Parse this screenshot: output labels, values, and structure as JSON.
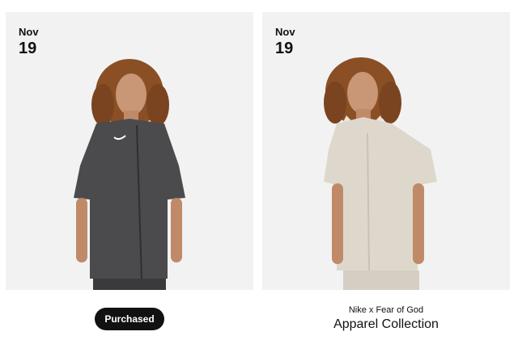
{
  "cards": [
    {
      "date": {
        "month": "Nov",
        "day": "19"
      },
      "shirt_color": "#4b4b4e",
      "button_label": "Purchased"
    },
    {
      "date": {
        "month": "Nov",
        "day": "19"
      },
      "shirt_color": "#ddd8cb",
      "subtitle": "Nike x Fear of God",
      "title": "Apparel Collection"
    }
  ]
}
